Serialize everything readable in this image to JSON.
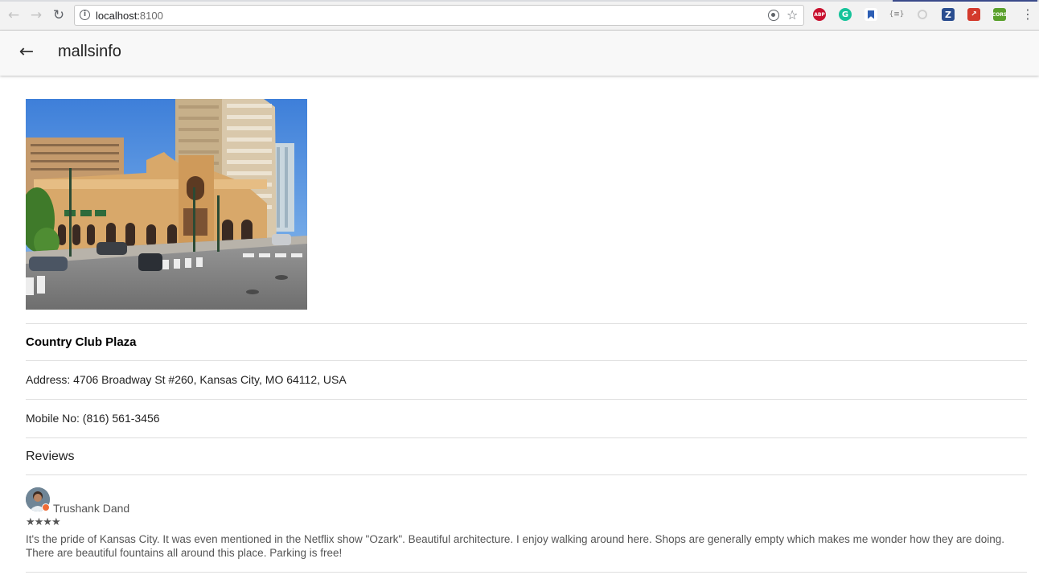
{
  "browser": {
    "url_host": "localhost:",
    "url_port": "8100",
    "extensions": [
      {
        "name": "adblock-plus",
        "label": "ABP"
      },
      {
        "name": "grammarly",
        "label": "G"
      },
      {
        "name": "bookmark",
        "label": ""
      },
      {
        "name": "json-viewer",
        "label": "{≡}"
      },
      {
        "name": "ghostery",
        "label": ""
      },
      {
        "name": "zotero",
        "label": "Z"
      },
      {
        "name": "red-extension",
        "label": "↗"
      },
      {
        "name": "cors",
        "label": "CORS"
      }
    ]
  },
  "header": {
    "title": "mallsinfo",
    "back_icon": "arrow-back-icon"
  },
  "mall": {
    "name": "Country Club Plaza",
    "address": "Address: 4706 Broadway St #260, Kansas City, MO 64112, USA",
    "mobile": "Mobile No: (816) 561-3456",
    "image_alt": "Country Club Plaza street view"
  },
  "reviews": {
    "heading": "Reviews",
    "items": [
      {
        "author": "Trushank Dand",
        "rating": 4,
        "stars": "★★★★",
        "text": "It's the pride of Kansas City. It was even mentioned in the Netflix show \"Ozark\". Beautiful architecture. I enjoy walking around here. Shops are generally empty which makes me wonder how they are doing. There are beautiful fountains all around this place. Parking is free!"
      }
    ]
  }
}
